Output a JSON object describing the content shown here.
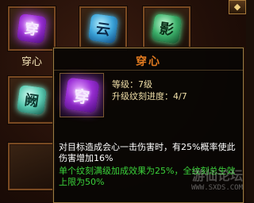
{
  "slots": [
    {
      "glyph": "穿",
      "label": "穿心",
      "color": "purple"
    },
    {
      "glyph": "云",
      "label": "",
      "color": "blue"
    },
    {
      "glyph": "影",
      "label": "",
      "color": "green"
    },
    {
      "glyph": "阙",
      "label": "",
      "color": "teal"
    }
  ],
  "corner_button_icon": "diamond-icon",
  "tooltip": {
    "title": "穿心",
    "icon_glyph": "穿",
    "level": "等级：7级",
    "engrave_progress": "升级纹刻进度：4/7",
    "description": "对目标造成会心一击伤害时，有25%概率使此伤害增加16%",
    "bonus": "单个纹刻满级加成效果为25%，全纹刻总生效上限为50%"
  },
  "watermark": {
    "text": "游仙论坛",
    "url": "WWW.SXDS.COM"
  },
  "colors": {
    "title": "#e07a20",
    "bonus": "#3ad23a",
    "border": "#9a7a44"
  }
}
